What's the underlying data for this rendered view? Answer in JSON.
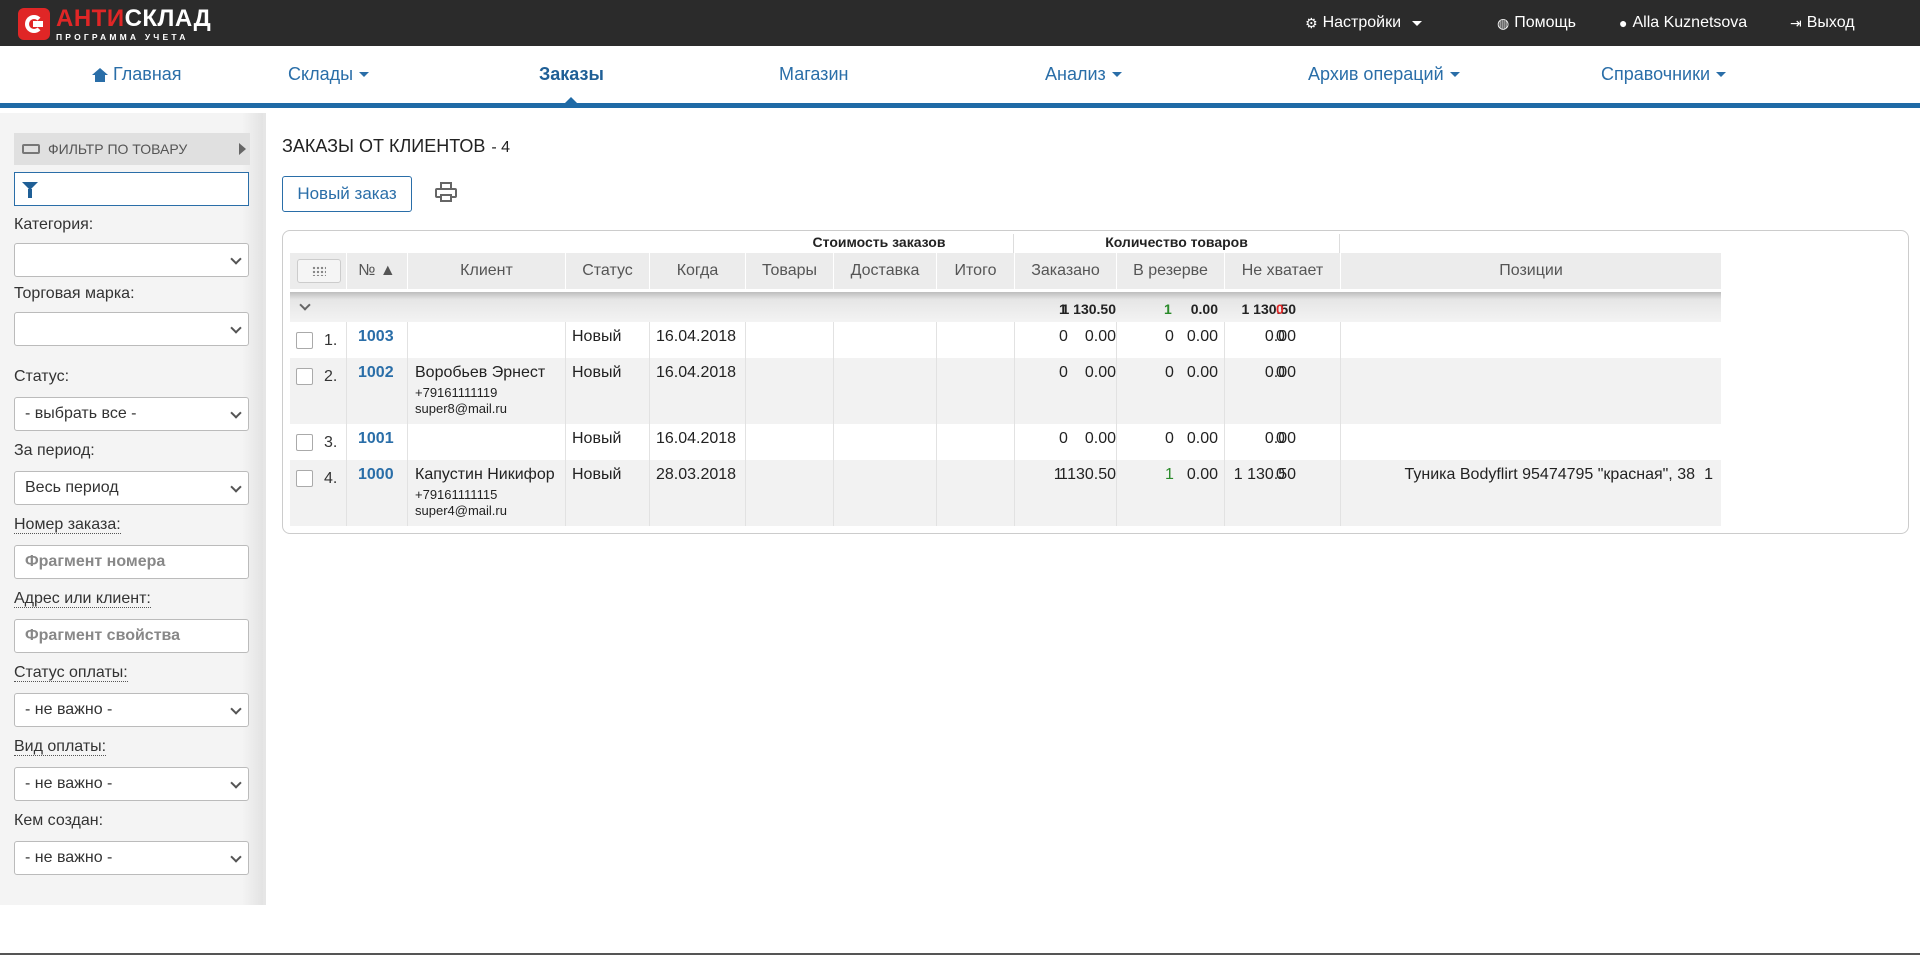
{
  "app": {
    "logo_part1": "АНТИ",
    "logo_part2": "СКЛАД",
    "logo_sub": "ПРОГРАММА УЧЕТА"
  },
  "topbar": {
    "settings": "Настройки",
    "help": "Помощь",
    "user": "Alla Kuznetsova",
    "logout": "Выход"
  },
  "nav": {
    "home": "Главная",
    "warehouses": "Склады",
    "orders": "Заказы",
    "shop": "Магазин",
    "analysis": "Анализ",
    "archive": "Архив операций",
    "refs": "Справочники"
  },
  "sidebar": {
    "filter_title": "ФИЛЬТР ПО ТОВАРУ",
    "category_label": "Категория:",
    "category_value": "",
    "brand_label": "Торговая марка:",
    "brand_value": "",
    "status_label": "Статус:",
    "status_value": "- выбрать все -",
    "period_label": "За период:",
    "period_value": "Весь период",
    "order_no_label": "Номер заказа:",
    "order_no_placeholder": "Фрагмент номера",
    "address_label": "Адрес или клиент:",
    "address_placeholder": "Фрагмент свойства",
    "pay_status_label": "Статус оплаты:",
    "pay_status_value": "- не важно -",
    "pay_type_label": "Вид оплаты:",
    "pay_type_value": "- не важно -",
    "created_by_label": "Кем создан:",
    "created_by_value": "- не важно -"
  },
  "content": {
    "title": "ЗАКАЗЫ ОТ КЛИЕНТОВ",
    "count": "- 4",
    "new_order": "Новый заказ"
  },
  "table": {
    "group_cost": "Стоимость заказов",
    "group_qty": "Количество товаров",
    "headers": {
      "no": "№ ▲",
      "client": "Клиент",
      "status": "Статус",
      "when": "Когда",
      "goods": "Товары",
      "delivery": "Доставка",
      "total": "Итого",
      "ordered": "Заказано",
      "reserved": "В резерве",
      "missing": "Не хватает",
      "positions": "Позиции"
    },
    "summary": {
      "goods": "1 130.50",
      "delivery": "0.00",
      "total": "1 130.50",
      "ordered": "1",
      "reserved": "1",
      "missing": "0"
    },
    "rows": [
      {
        "num": "1.",
        "id": "1003",
        "client": "",
        "phone": "",
        "email": "",
        "status": "Новый",
        "when": "16.04.2018",
        "goods": "0.00",
        "delivery": "0.00",
        "total": "0.00",
        "ordered": "0",
        "reserved": "0",
        "missing": "0",
        "positions": ""
      },
      {
        "num": "2.",
        "id": "1002",
        "client": "Воробьев Эрнест",
        "phone": "+79161111119",
        "email": "super8@mail.ru",
        "status": "Новый",
        "when": "16.04.2018",
        "goods": "0.00",
        "delivery": "0.00",
        "total": "0.00",
        "ordered": "0",
        "reserved": "0",
        "missing": "0",
        "positions": ""
      },
      {
        "num": "3.",
        "id": "1001",
        "client": "",
        "phone": "",
        "email": "",
        "status": "Новый",
        "when": "16.04.2018",
        "goods": "0.00",
        "delivery": "0.00",
        "total": "0.00",
        "ordered": "0",
        "reserved": "0",
        "missing": "0",
        "positions": ""
      },
      {
        "num": "4.",
        "id": "1000",
        "client": "Капустин Никифор",
        "phone": "+79161111115",
        "email": "super4@mail.ru",
        "status": "Новый",
        "when": "28.03.2018",
        "goods": "1 130.50",
        "delivery": "0.00",
        "total": "1 130.50",
        "ordered": "1",
        "reserved": "1",
        "missing": "0",
        "positions": "Туника Bodyflirt 95474795 \"красная\", 38",
        "positions_qty": "1"
      }
    ]
  },
  "icons": {
    "settings": "gear-icon",
    "help": "globe-icon",
    "user": "user-icon",
    "logout": "logout-icon",
    "home": "home-icon",
    "filter": "funnel-icon",
    "print": "print-icon",
    "columns": "grid-icon"
  },
  "colors": {
    "topbar": "#2b2b2b",
    "accent": "#2a6ea8",
    "logo_red": "#e02626",
    "ok_green": "#2a8a2a",
    "warn_red": "#e02626"
  }
}
